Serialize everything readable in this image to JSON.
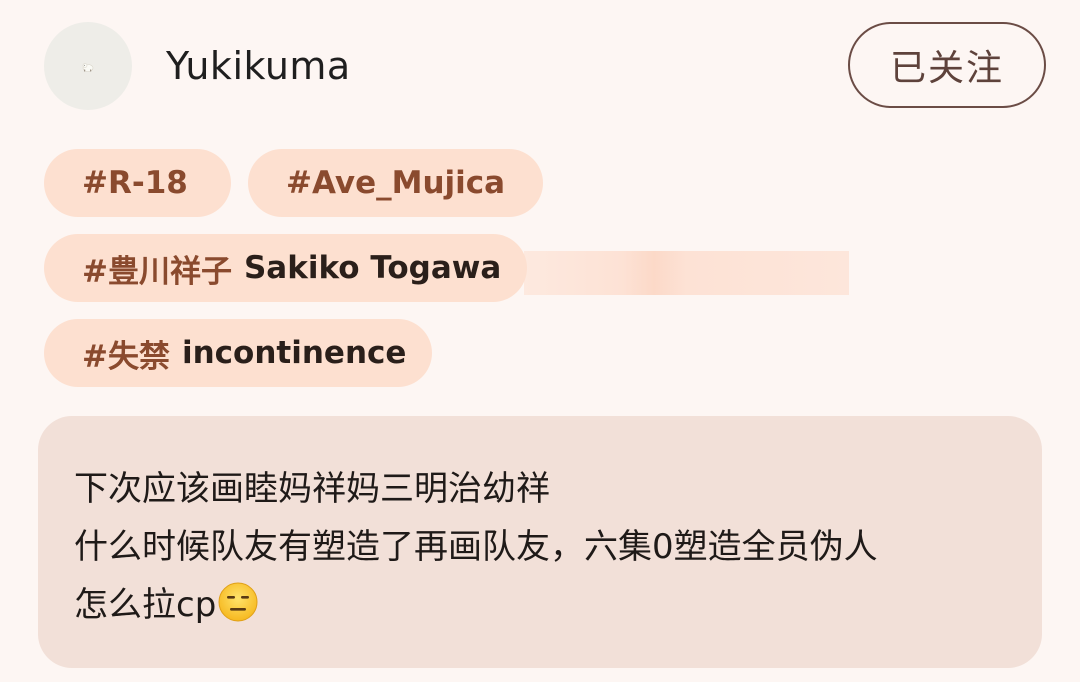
{
  "user": {
    "name": "Yukikuma",
    "avatar_icon": "polar-bear-avatar",
    "follow_label": "已关注"
  },
  "tags": [
    {
      "hash": "#R-18",
      "extra": ""
    },
    {
      "hash": "#Ave_Mujica",
      "extra": ""
    },
    {
      "hash": "#豊川祥子",
      "extra": "Sakiko Togawa"
    },
    {
      "hash": "#失禁",
      "extra": "incontinence"
    }
  ],
  "comment": {
    "lines": [
      "下次应该画睦妈祥妈三明治幼祥",
      "什么时候队友有塑造了再画队友，六集0塑造全员伪人",
      "怎么拉cp"
    ],
    "emoji": "expressionless-face-emoji"
  },
  "colors": {
    "background": "#fdf6f3",
    "tag_bg": "#fde0d0",
    "tag_hash": "#8a4a2e",
    "comment_bg": "#f2e0d8",
    "follow_border": "#6b4c45"
  }
}
